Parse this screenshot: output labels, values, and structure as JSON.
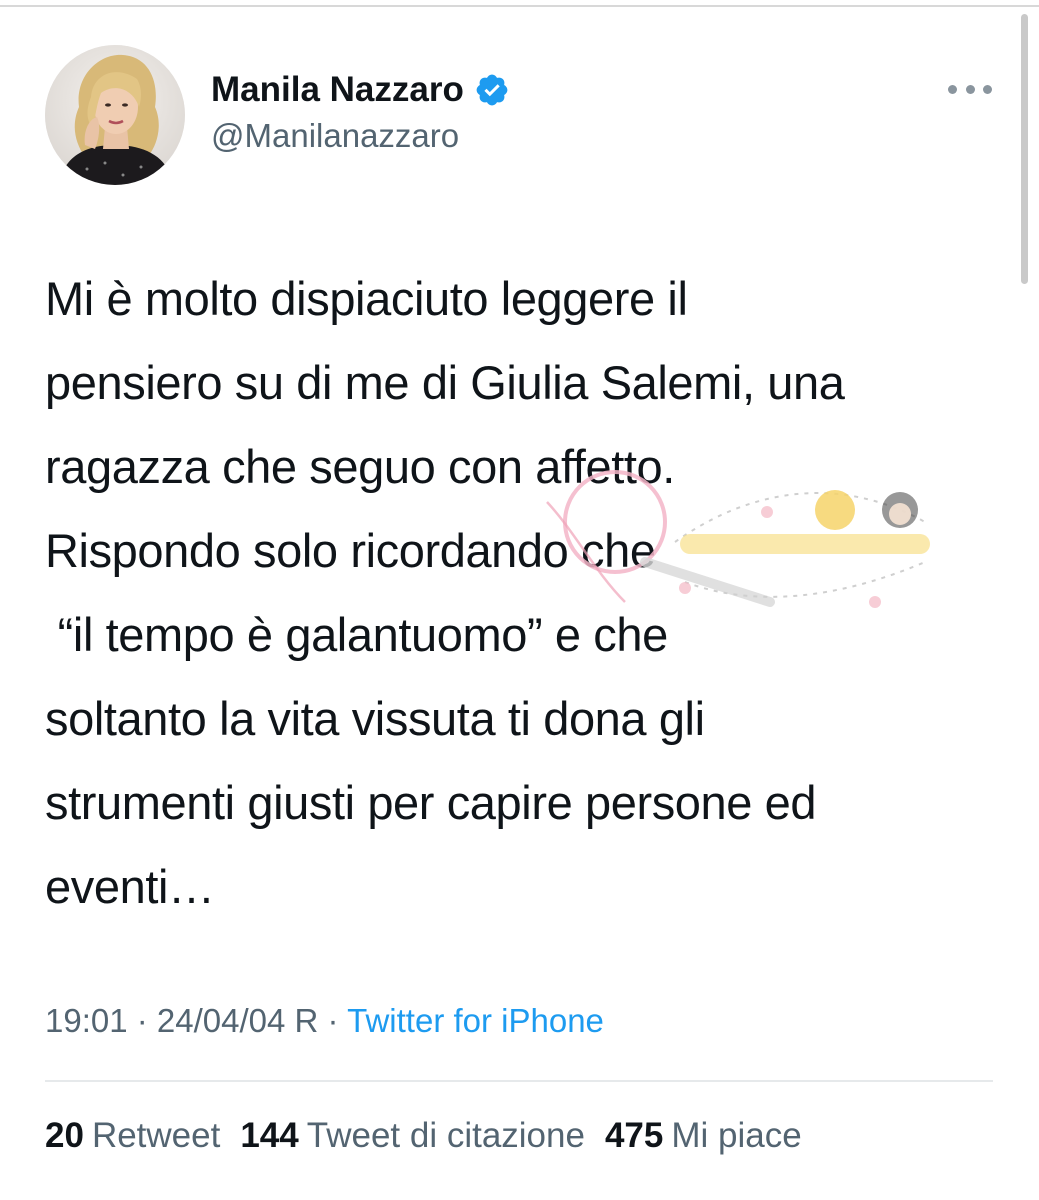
{
  "author": {
    "display_name": "Manila Nazzaro",
    "handle": "@Manilanazzaro",
    "verified": true,
    "verified_badge_color": "#1d9bf0"
  },
  "tweet": {
    "lines": [
      "Mi è molto dispiaciuto leggere il",
      "pensiero su di me di Giulia Salemi, una",
      "ragazza che seguo con affetto.",
      "Rispondo solo ricordando che",
      " “il tempo è galantuomo” e che",
      "soltanto la vita vissuta ti dona gli",
      "strumenti giusti per capire persone ed",
      "eventi…"
    ]
  },
  "meta": {
    "time": "19:01",
    "date": "24/04/04 R",
    "separator": " · ",
    "source": "Twitter for iPhone"
  },
  "stats": {
    "retweets_count": "20",
    "retweets_label": "Retweet",
    "quotes_count": "144",
    "quotes_label": "Tweet di citazione",
    "likes_count": "475",
    "likes_label": "Mi piace"
  },
  "icons": {
    "more": "more-options-icon",
    "verified": "verified-badge-icon"
  },
  "colors": {
    "text_primary": "#0f1419",
    "text_secondary": "#536471",
    "link": "#1d9bf0"
  }
}
